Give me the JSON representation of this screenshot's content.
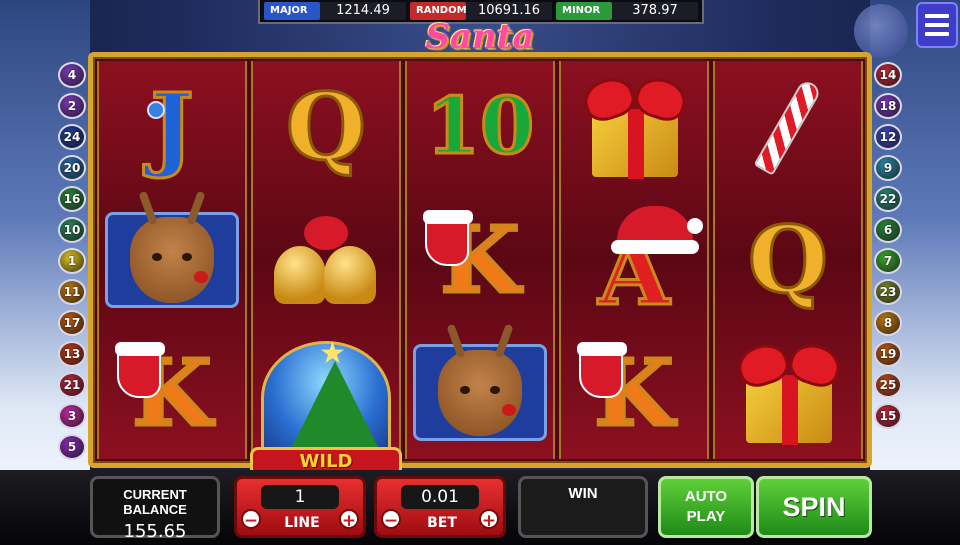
{
  "game": {
    "title": "Santa"
  },
  "jackpots": [
    {
      "label": "MAJOR",
      "value": "1214.49",
      "color": "#2a55c8"
    },
    {
      "label": "RANDOM",
      "value": "10691.16",
      "color": "#c42a2a"
    },
    {
      "label": "MINOR",
      "value": "378.97",
      "color": "#2a9a3a"
    }
  ],
  "paylines": {
    "left": [
      {
        "num": "4",
        "color": "#7a3ab8"
      },
      {
        "num": "2",
        "color": "#7a3ab8"
      },
      {
        "num": "24",
        "color": "#1e3f9a"
      },
      {
        "num": "20",
        "color": "#2a6aa8"
      },
      {
        "num": "16",
        "color": "#2a8a3a"
      },
      {
        "num": "10",
        "color": "#2a8a5a"
      },
      {
        "num": "1",
        "color": "#e0c020"
      },
      {
        "num": "11",
        "color": "#c07a10"
      },
      {
        "num": "17",
        "color": "#c05a10"
      },
      {
        "num": "13",
        "color": "#c03a1a"
      },
      {
        "num": "21",
        "color": "#b8283a"
      },
      {
        "num": "3",
        "color": "#c02aa0"
      },
      {
        "num": "5",
        "color": "#8a2ab8"
      }
    ],
    "right": [
      {
        "num": "14",
        "color": "#c0283a"
      },
      {
        "num": "18",
        "color": "#7a3ab8"
      },
      {
        "num": "12",
        "color": "#3a4ab8"
      },
      {
        "num": "9",
        "color": "#2a8aa8"
      },
      {
        "num": "22",
        "color": "#2a8a7a"
      },
      {
        "num": "6",
        "color": "#2a8a3a"
      },
      {
        "num": "7",
        "color": "#3aa82a"
      },
      {
        "num": "23",
        "color": "#7a8a2a"
      },
      {
        "num": "8",
        "color": "#c07a10"
      },
      {
        "num": "19",
        "color": "#c05a10"
      },
      {
        "num": "25",
        "color": "#c04a1a"
      },
      {
        "num": "15",
        "color": "#c0283a"
      }
    ]
  },
  "reels": [
    [
      "J",
      "reindeer-icon",
      "K"
    ],
    [
      "Q",
      "bells-icon",
      "wild-tree-icon"
    ],
    [
      "10",
      "K",
      "reindeer-icon"
    ],
    [
      "gift-icon",
      "A",
      "K"
    ],
    [
      "candy-cane-icon",
      "Q",
      "gift-icon"
    ]
  ],
  "wild_label": "WILD",
  "controls": {
    "balance_label": "CURRENT BALANCE",
    "balance_value": "155.65",
    "line_value": "1",
    "line_label": "LINE",
    "bet_value": "0.01",
    "bet_label": "BET",
    "minus_label": "−",
    "plus_label": "+",
    "win_label": "WIN",
    "auto_line1": "AUTO",
    "auto_line2": "PLAY",
    "spin_label": "SPIN"
  }
}
